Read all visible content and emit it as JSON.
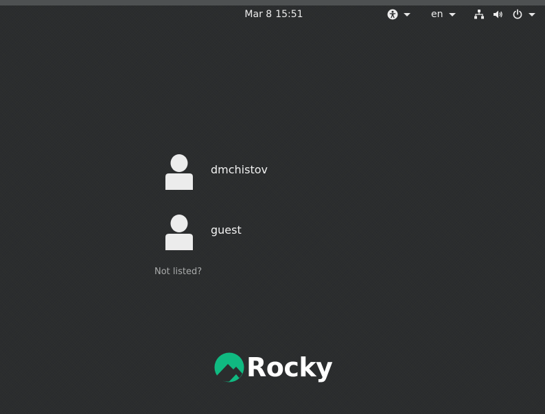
{
  "top_bar": {
    "date": "Mar 8",
    "time": "15:51",
    "language": "en",
    "icons": [
      "accessibility-icon",
      "network-icon",
      "volume-icon",
      "power-icon"
    ]
  },
  "users": [
    {
      "name": "dmchistov",
      "icon": "avatar-icon"
    },
    {
      "name": "guest",
      "icon": "avatar-icon"
    }
  ],
  "not_listed_label": "Not listed?",
  "logo": {
    "text": "Rocky",
    "brand_color": "#10b981"
  },
  "colors": {
    "background": "#2b2d2e",
    "top_strip": "#4e5152",
    "text": "#ececec",
    "muted_text": "#a9abab"
  }
}
